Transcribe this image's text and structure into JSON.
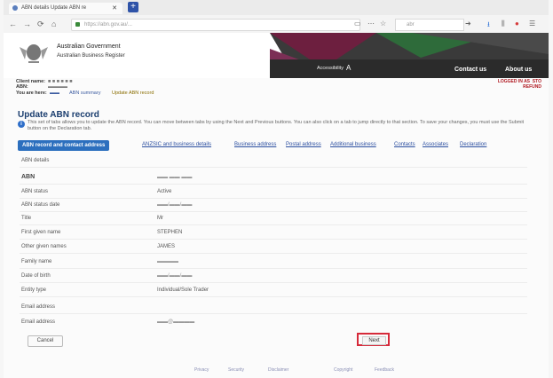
{
  "browser": {
    "tab_title": "ABN details  Update ABN re",
    "tab_close": "✕",
    "new_tab": "+",
    "url": "https://abn.gov.au/...",
    "search_placeholder": "abr"
  },
  "header": {
    "gov": "Australian Government",
    "abr": "Australian Business Register",
    "accessibility": "Accessibility",
    "font_a": "A",
    "contact": "Contact us",
    "about": "About us",
    "logout": "LOGGED IN AS  STO\nREFUND"
  },
  "user": {
    "client_label": "Client name:",
    "abn_label": "ABN:",
    "here_label": "You are here:",
    "breadcrumb_2": "ABN summary",
    "breadcrumb_3": "Update ABN record"
  },
  "page": {
    "title": "Update ABN record",
    "info_icon": "i",
    "intro": "This set of tabs allows you to update the ABN record. You can move between tabs by using the Next and Previous buttons. You can also click on a tab to jump directly to that section. To save your changes, you must use the Submit button on the Declaration tab."
  },
  "tabs": [
    "ABN record and contact address",
    "ANZSIC and business details",
    "Business address",
    "Postal address",
    "Additional business",
    "Contacts",
    "Associates",
    "Declaration"
  ],
  "section_title": "ABN details",
  "fields": [
    {
      "label": "ABN",
      "value": ""
    },
    {
      "label": "ABN status",
      "value": "Active"
    },
    {
      "label": "ABN status date",
      "value": ""
    },
    {
      "label": "Title",
      "value": "Mr"
    },
    {
      "label": "First given name",
      "value": "STEPHEN"
    },
    {
      "label": "Other given names",
      "value": "JAMES"
    },
    {
      "label": "Family name",
      "value": ""
    },
    {
      "label": "Date of birth",
      "value": ""
    },
    {
      "label": "Entity type",
      "value": "Individual/Sole Trader"
    }
  ],
  "email_section": "Email address",
  "email_label": "Email address",
  "email_value": "",
  "buttons": {
    "cancel": "Cancel",
    "next": "Next"
  },
  "footer": [
    "Privacy",
    "Security",
    "Disclaimer",
    "Copyright",
    "Feedback"
  ]
}
